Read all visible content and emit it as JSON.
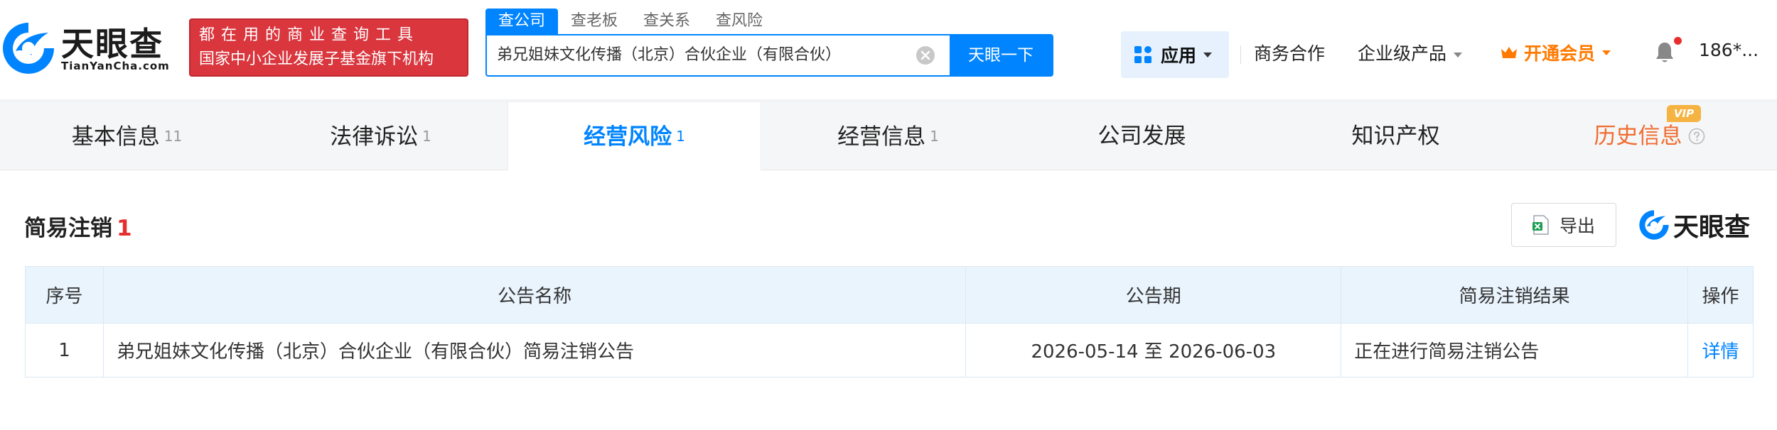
{
  "header": {
    "logo_text": "天眼查",
    "logo_sub": "TianYanCha.com",
    "slogan_line1": "都在用的商业查询工具",
    "slogan_line2": "国家中小企业发展子基金旗下机构",
    "search_tabs": [
      "查公司",
      "查老板",
      "查关系",
      "查风险"
    ],
    "search_value": "弟兄姐妹文化传播（北京）合伙企业（有限合伙）",
    "search_button": "天眼一下",
    "app_label": "应用",
    "nav_business": "商务合作",
    "nav_enterprise": "企业级产品",
    "nav_vip": "开通会员",
    "user": "186*..."
  },
  "tabs": [
    {
      "label": "基本信息",
      "count": "11"
    },
    {
      "label": "法律诉讼",
      "count": "1"
    },
    {
      "label": "经营风险",
      "count": "1"
    },
    {
      "label": "经营信息",
      "count": "1"
    },
    {
      "label": "公司发展",
      "count": ""
    },
    {
      "label": "知识产权",
      "count": ""
    },
    {
      "label": "历史信息",
      "count": ""
    }
  ],
  "vip_badge": "VIP",
  "section": {
    "title": "简易注销",
    "count": "1",
    "export_label": "导出",
    "brand": "天眼查"
  },
  "table": {
    "headers": [
      "序号",
      "公告名称",
      "公告期",
      "简易注销结果",
      "操作"
    ],
    "rows": [
      [
        "1",
        "弟兄姐妹文化传播（北京）合伙企业（有限合伙）简易注销公告",
        "2026-05-14 至 2026-06-03",
        "正在进行简易注销公告",
        "详情"
      ]
    ]
  },
  "colors": {
    "primary": "#0084ff",
    "slogan_red": "#d9363e",
    "vip_orange": "#ff7a00",
    "history_orange": "#f06b2f",
    "count_red": "#e62e2e"
  }
}
